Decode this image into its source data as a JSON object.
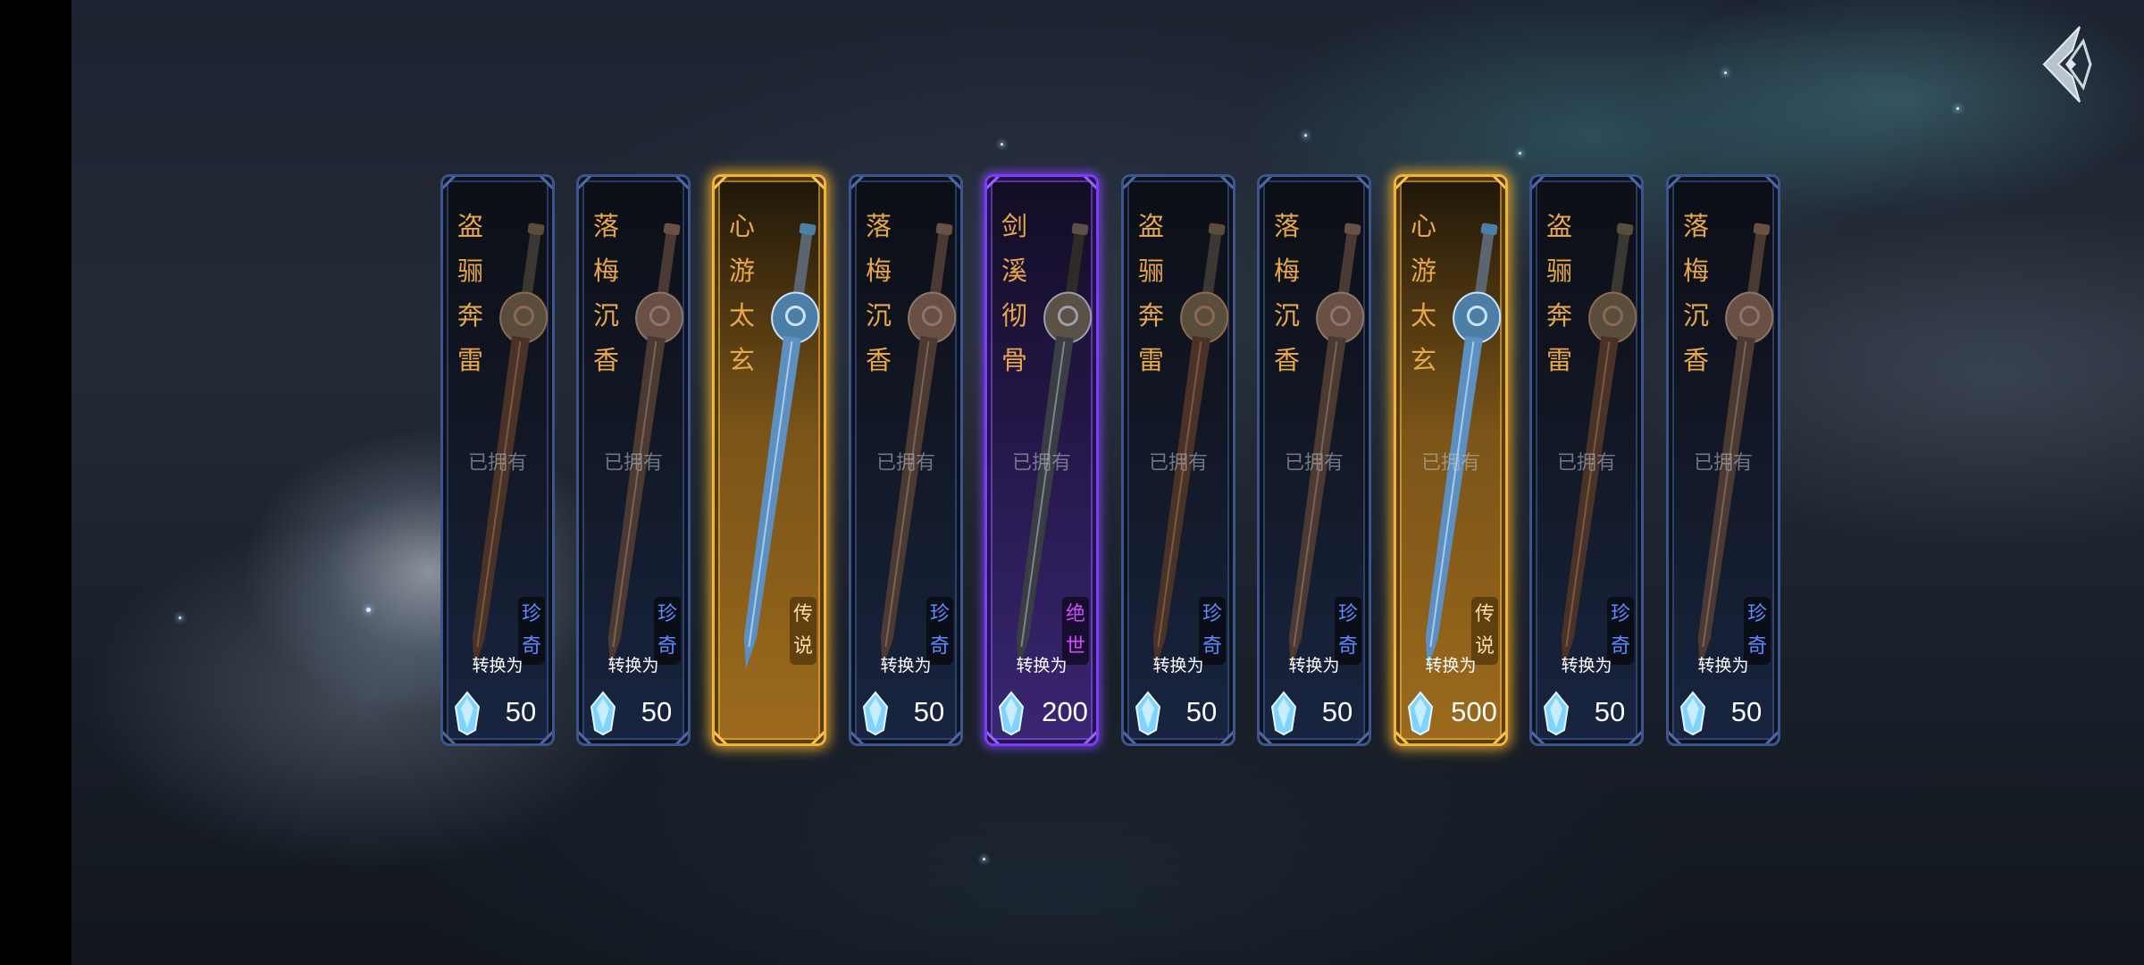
{
  "screen": {
    "back_icon": "diamond-back-icon",
    "colors": {
      "common_border": "#3c558e",
      "legend_border": "#f2b33a",
      "epic_border": "#7d3bff",
      "name_text": "#e8a84a",
      "rarity_rare": "#5f8bff",
      "rarity_legend": "#f6e0a0",
      "rarity_epic": "#d24cff"
    }
  },
  "cards": [
    {
      "name": "盗骊奔雷",
      "owned": "已拥有",
      "rarity": "珍奇",
      "tier": "rare",
      "convert": "转换为",
      "amount": "50",
      "currency_icon": "crystal-icon",
      "blade": "bronze"
    },
    {
      "name": "落梅沉香",
      "owned": "已拥有",
      "rarity": "珍奇",
      "tier": "rare",
      "convert": "转换为",
      "amount": "50",
      "currency_icon": "crystal-icon",
      "blade": "rust"
    },
    {
      "name": "心游太玄",
      "owned": "",
      "rarity": "传说",
      "tier": "legend",
      "convert": "",
      "amount": "",
      "currency_icon": "",
      "blade": "ice"
    },
    {
      "name": "落梅沉香",
      "owned": "已拥有",
      "rarity": "珍奇",
      "tier": "rare",
      "convert": "转换为",
      "amount": "50",
      "currency_icon": "crystal-icon",
      "blade": "rust"
    },
    {
      "name": "剑溪彻骨",
      "owned": "已拥有",
      "rarity": "绝世",
      "tier": "epic",
      "convert": "转换为",
      "amount": "200",
      "currency_icon": "crystal-icon",
      "blade": "dark"
    },
    {
      "name": "盗骊奔雷",
      "owned": "已拥有",
      "rarity": "珍奇",
      "tier": "rare",
      "convert": "转换为",
      "amount": "50",
      "currency_icon": "crystal-icon",
      "blade": "bronze"
    },
    {
      "name": "落梅沉香",
      "owned": "已拥有",
      "rarity": "珍奇",
      "tier": "rare",
      "convert": "转换为",
      "amount": "50",
      "currency_icon": "crystal-icon",
      "blade": "rust"
    },
    {
      "name": "心游太玄",
      "owned": "已拥有",
      "rarity": "传说",
      "tier": "legend",
      "convert": "转换为",
      "amount": "500",
      "currency_icon": "crystal-icon",
      "blade": "ice"
    },
    {
      "name": "盗骊奔雷",
      "owned": "已拥有",
      "rarity": "珍奇",
      "tier": "rare",
      "convert": "转换为",
      "amount": "50",
      "currency_icon": "crystal-icon",
      "blade": "bronze"
    },
    {
      "name": "落梅沉香",
      "owned": "已拥有",
      "rarity": "珍奇",
      "tier": "rare",
      "convert": "转换为",
      "amount": "50",
      "currency_icon": "crystal-icon",
      "blade": "rust"
    }
  ]
}
